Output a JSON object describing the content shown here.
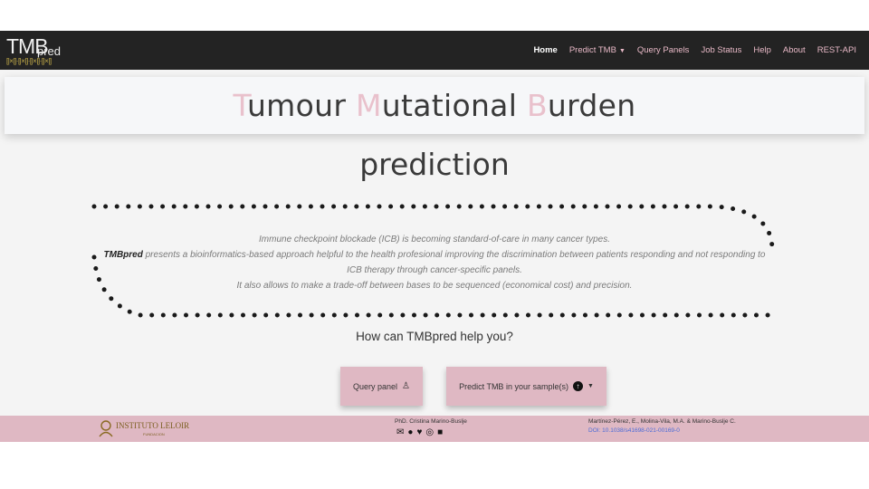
{
  "navbar": {
    "logo_main": "TM",
    "logo_b": "B",
    "logo_sub": "pred",
    "logo_dna": "[|×|]·[|×|]·[|×|]·[|×|]",
    "items": [
      "Home",
      "Predict TMB",
      "Query Panels",
      "Job Status",
      "Help",
      "About",
      "REST-API"
    ]
  },
  "title": {
    "t1": "T",
    "r1": "umour ",
    "t2": "M",
    "r2": "utational ",
    "t3": "B",
    "r3": "urden",
    "subtitle": "prediction"
  },
  "description": {
    "line1": "Immune checkpoint blockade (ICB) is becoming standard-of-care in many cancer types.",
    "brand": "TMBpred",
    "line2": " presents a bioinformatics-based approach helpful to the health profesional improving the discrimination between patients responding and not responding to ICB therapy through cancer-specific panels.",
    "line3": "It also allows to make a trade-off between bases to be sequenced (economical cost) and precision."
  },
  "question": "How can TMBpred help you?",
  "buttons": {
    "query": "Query panel",
    "predict": "Predict TMB in your sample(s)"
  },
  "footer": {
    "institute": "INSTITUTO LELOIR",
    "institute_sub": "FUNDACION",
    "author": "PhD. Cristina Marino-Buslje",
    "citation": "Martínez-Pérez, E., Molina-Vila, M.A. & Marino-Buslje C.",
    "doi": "DOI: 10.1038/s41698-021-00169-0"
  },
  "colors": {
    "navbar": "#232323",
    "accent_pink": "#dfb8c3",
    "title_highlight": "#e9c1cc",
    "link_blue": "#4a6bd8"
  },
  "icons": [
    "user-icon",
    "upload-circle-icon",
    "caret-down-icon",
    "email-icon",
    "github-icon",
    "twitter-icon",
    "instagram-icon",
    "linkedin-icon",
    "leloir-logo"
  ]
}
